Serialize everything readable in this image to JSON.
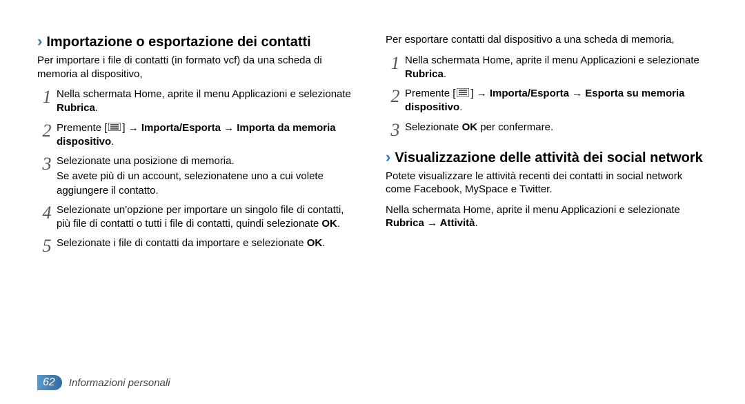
{
  "left": {
    "heading": "Importazione o esportazione dei contatti",
    "intro": "Per importare i file di contatti (in formato vcf) da una scheda di memoria al dispositivo,",
    "steps": [
      {
        "num": "1",
        "pre": "Nella schermata Home, aprite il menu Applicazioni e selezionate ",
        "bold": "Rubrica",
        "post": "."
      },
      {
        "num": "2",
        "pre": "Premente [",
        "icon": true,
        "mid": "] → ",
        "bold": "Importa/Esporta → Importa da memoria dispositivo",
        "post": "."
      },
      {
        "num": "3",
        "text": "Selezionate una posizione di memoria.",
        "sub": "Se avete più di un account, selezionatene uno a cui volete aggiungere il contatto."
      },
      {
        "num": "4",
        "pre": "Selezionate un'opzione per importare un singolo file di contatti, più file di contatti o tutti i file di contatti, quindi selezionate ",
        "bold": "OK",
        "post": "."
      },
      {
        "num": "5",
        "pre": "Selezionate i file di contatti da importare e selezionate ",
        "bold": "OK",
        "post": "."
      }
    ]
  },
  "right": {
    "intro": "Per esportare contatti dal dispositivo a una scheda di memoria,",
    "steps": [
      {
        "num": "1",
        "pre": "Nella schermata Home, aprite il menu Applicazioni e selezionate ",
        "bold": "Rubrica",
        "post": "."
      },
      {
        "num": "2",
        "pre": "Premente [",
        "icon": true,
        "mid": "] → ",
        "bold": "Importa/Esporta → Esporta su memoria dispositivo",
        "post": "."
      },
      {
        "num": "3",
        "pre": "Selezionate ",
        "bold": "OK",
        "post": " per confermare."
      }
    ],
    "heading2": "Visualizzazione delle attività dei social network",
    "para1": "Potete visualizzare le attività recenti dei contatti in social network come Facebook, MySpace e Twitter.",
    "para2_pre": "Nella schermata Home, aprite il menu Applicazioni e selezionate ",
    "para2_bold": "Rubrica → Attività",
    "para2_post": "."
  },
  "footer": {
    "page": "62",
    "section": "Informazioni personali"
  }
}
